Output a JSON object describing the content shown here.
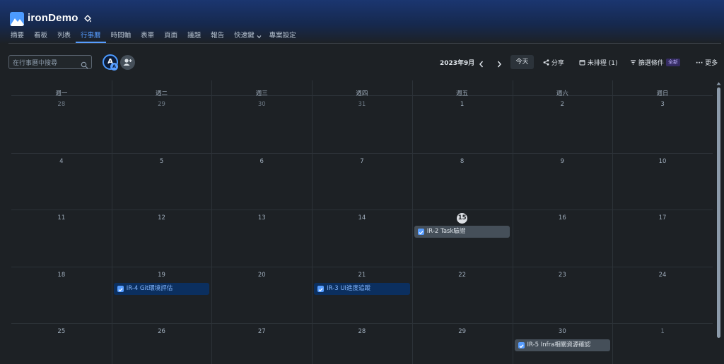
{
  "app": {
    "title": "ironDemo"
  },
  "tabs": [
    {
      "label": "摘要"
    },
    {
      "label": "看板"
    },
    {
      "label": "列表"
    },
    {
      "label": "行事曆",
      "active": true
    },
    {
      "label": "時間軸"
    },
    {
      "label": "表單"
    },
    {
      "label": "頁面"
    },
    {
      "label": "議題"
    },
    {
      "label": "報告"
    },
    {
      "label": "快速鍵"
    },
    {
      "label": "專案設定"
    }
  ],
  "search": {
    "placeholder": "在行事曆中搜尋"
  },
  "avatar": {
    "initial": "A",
    "badge": "A"
  },
  "toolbar": {
    "month": "2023年9月",
    "today": "今天",
    "share": "分享",
    "unscheduled": "未排程 (1)",
    "filter": "篩選條件",
    "filter_badge": "全新",
    "more": "更多"
  },
  "weekdays": [
    "週一",
    "週二",
    "週三",
    "週四",
    "週五",
    "週六",
    "週日"
  ],
  "weeks": [
    [
      "28",
      "29",
      "30",
      "31",
      "1",
      "2",
      "3"
    ],
    [
      "4",
      "5",
      "6",
      "7",
      "8",
      "9",
      "10"
    ],
    [
      "11",
      "12",
      "13",
      "14",
      "15",
      "16",
      "17"
    ],
    [
      "18",
      "19",
      "20",
      "21",
      "22",
      "23",
      "24"
    ],
    [
      "25",
      "26",
      "27",
      "28",
      "29",
      "30",
      "1"
    ]
  ],
  "today": "15",
  "events": [
    {
      "label": "IR-2 Task驗證",
      "week": 2,
      "day": 4,
      "style": "grey"
    },
    {
      "label": "IR-4 Git環境評估",
      "week": 3,
      "day": 1,
      "style": "blue"
    },
    {
      "label": "IR-3 UI進度追蹤",
      "week": 3,
      "day": 3,
      "style": "blue"
    },
    {
      "label": "IR-5 Infra相關資源確認",
      "week": 4,
      "day": 5,
      "style": "grey"
    }
  ],
  "colors": {
    "accent": "#579dff",
    "background": "#1d2125",
    "header": "#1b3670"
  }
}
